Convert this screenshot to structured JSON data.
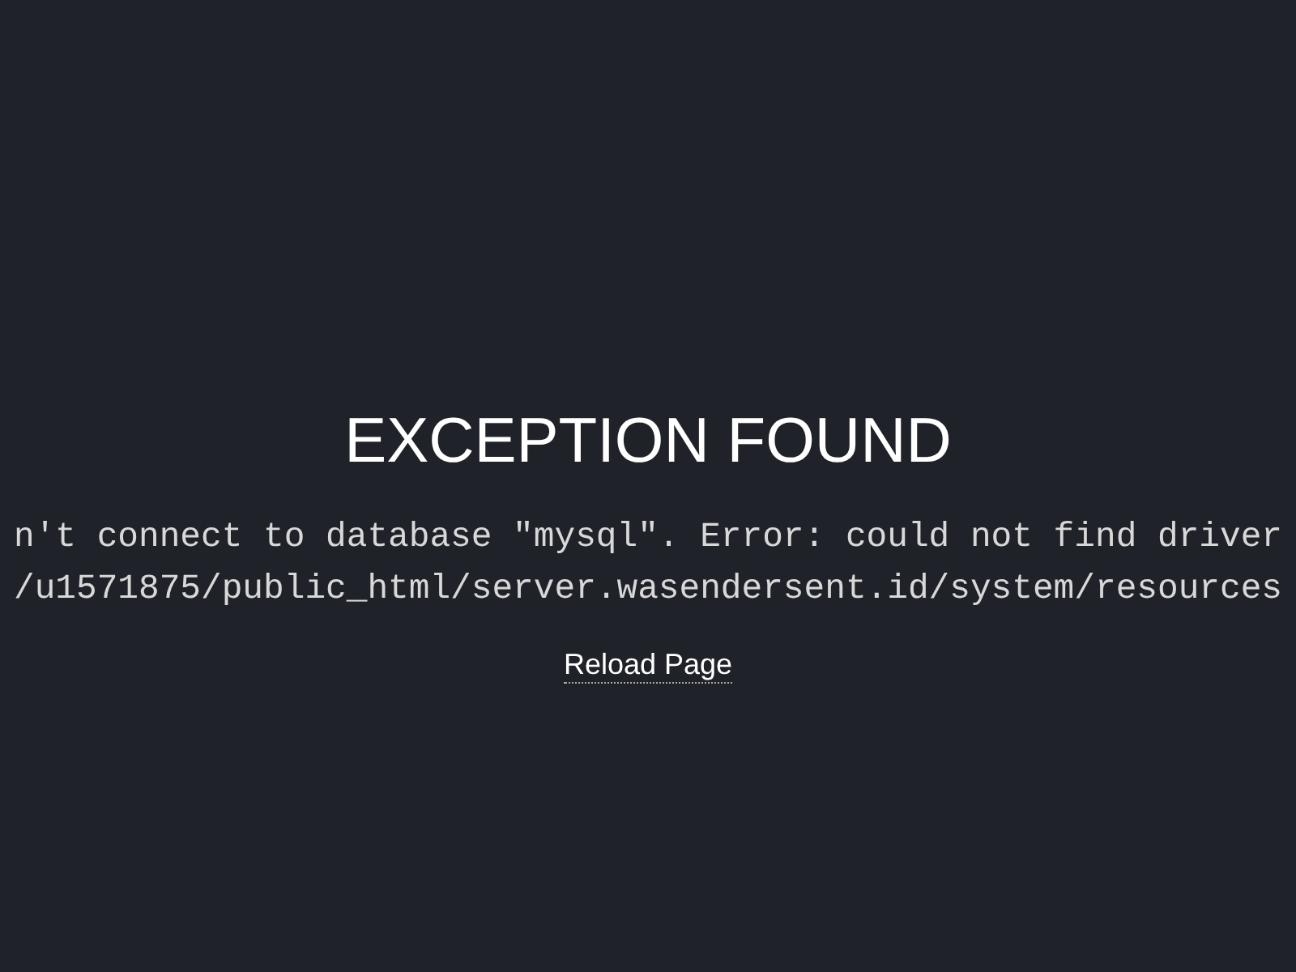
{
  "title": "EXCEPTION FOUND",
  "message_lines": [
    "n't connect to database \"mysql\". Error: could not find driver",
    "/u1571875/public_html/server.wasendersent.id/system/resources"
  ],
  "reload_link": "Reload Page"
}
